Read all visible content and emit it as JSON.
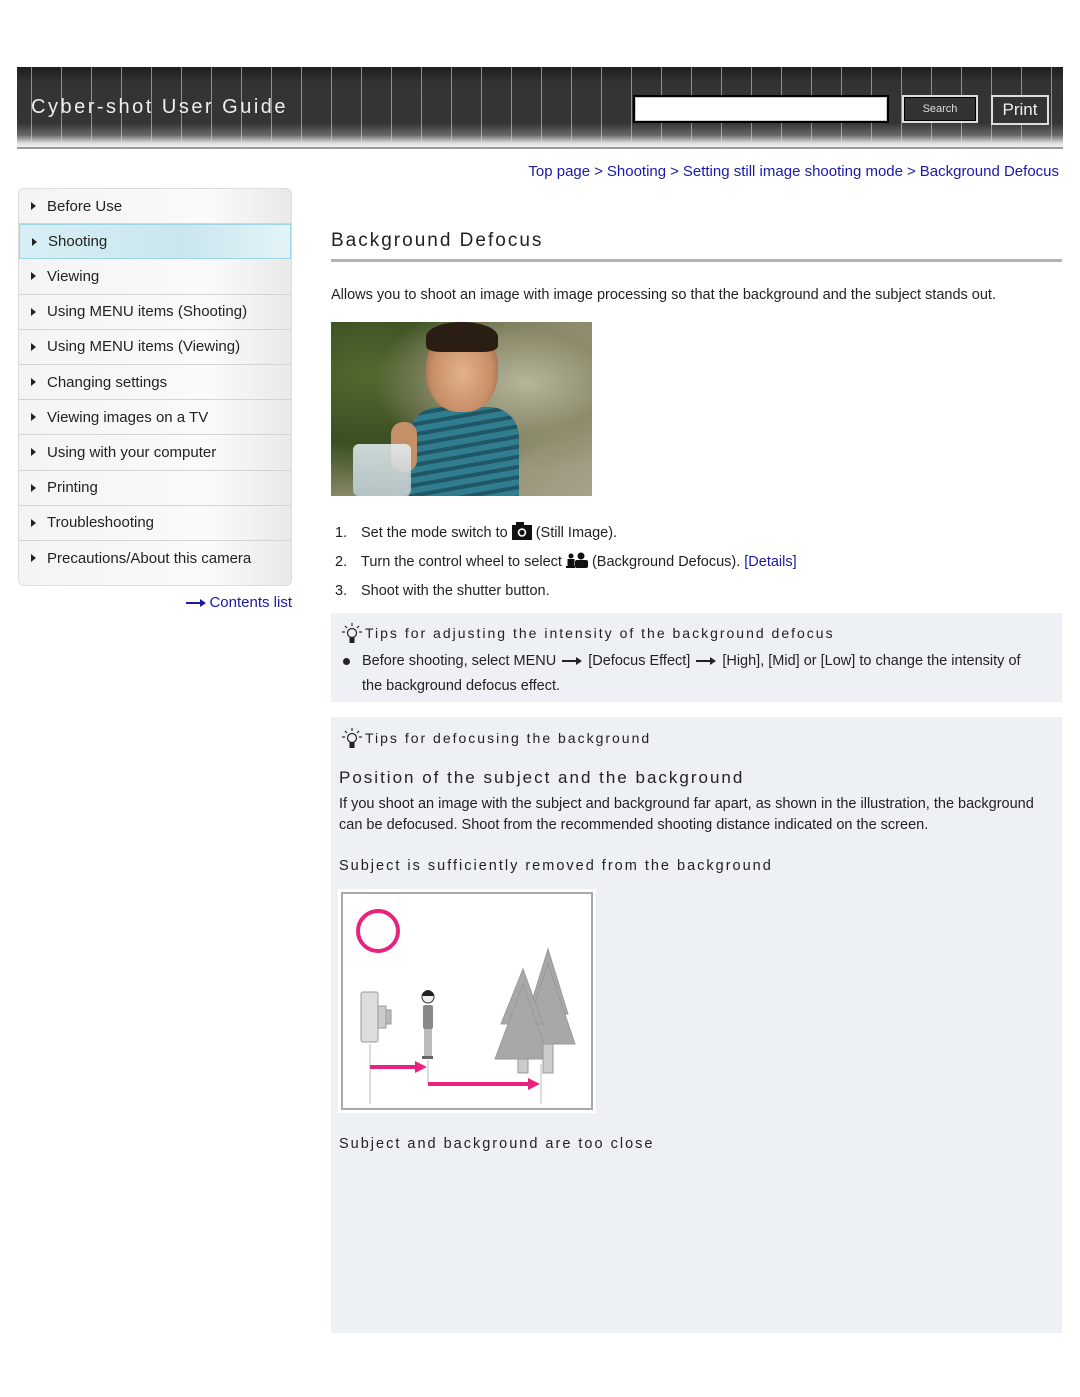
{
  "header": {
    "app_title": "Cyber-shot User Guide",
    "search_placeholder": "",
    "search_value": "",
    "search_label": "Search",
    "print_label": "Print"
  },
  "breadcrumb": [
    {
      "label": "Top page"
    },
    {
      "label": "Shooting"
    },
    {
      "label": "Setting still image shooting mode"
    },
    {
      "label": "Background Defocus"
    }
  ],
  "breadcrumb_separator": ">",
  "sidebar": {
    "items": [
      {
        "label": "Before Use",
        "active": false
      },
      {
        "label": "Shooting",
        "active": true
      },
      {
        "label": "Viewing",
        "active": false
      },
      {
        "label": "Using MENU items (Shooting)",
        "active": false
      },
      {
        "label": "Using MENU items (Viewing)",
        "active": false
      },
      {
        "label": "Changing settings",
        "active": false
      },
      {
        "label": "Viewing images on a TV",
        "active": false
      },
      {
        "label": "Using with your computer",
        "active": false
      },
      {
        "label": "Printing",
        "active": false
      },
      {
        "label": "Troubleshooting",
        "active": false
      },
      {
        "label": "Precautions/About this camera",
        "active": false
      }
    ],
    "contents_link": "Contents list"
  },
  "main": {
    "title": "Background Defocus",
    "intro": "Allows you to shoot an image with image processing so that the background and the subject stands out.",
    "steps": [
      {
        "num": "1.",
        "before": "Set the mode switch to",
        "icon": "still-image-camera-icon",
        "after": "(Still Image).",
        "link": ""
      },
      {
        "num": "2.",
        "before": "Turn the control wheel to select",
        "icon": "background-defocus-icon",
        "after": "(Background Defocus).",
        "link": "[Details]"
      },
      {
        "num": "3.",
        "before": "Shoot with the shutter button.",
        "icon": "",
        "after": "",
        "link": ""
      }
    ],
    "tip1": {
      "heading": "Tips for adjusting the intensity of the background defocus",
      "bullet_part1": "Before shooting, select MENU",
      "bullet_part2": "[Defocus Effect]",
      "bullet_part3": "[High], [Mid] or [Low] to change the intensity of the background defocus effect."
    },
    "tip2": {
      "heading": "Tips for defocusing the background",
      "subtitle": "Position of the subject and the background",
      "body": "If you shoot an image with the subject and background far apart, as shown in the illustration, the background can be defocused. Shoot from the recommended shooting distance indicated on the screen.",
      "caption_good": "Subject is sufficiently removed from the background",
      "caption_bad": "Subject and background are too close"
    },
    "colors": {
      "link": "#1a1aa6",
      "tip_bg": "#edf0f5",
      "illustration_accent": "#e8237d",
      "active_nav": "#c9e6ee"
    }
  }
}
